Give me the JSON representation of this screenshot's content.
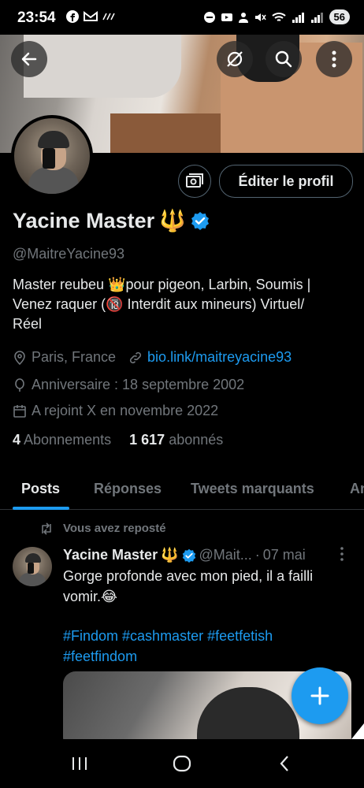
{
  "status_bar": {
    "time": "23:54",
    "battery": "56"
  },
  "profile": {
    "edit_button_label": "Éditer le profil",
    "display_name": "Yacine Master",
    "name_emoji": "🔱",
    "handle": "@MaitreYacine93",
    "bio_line1": "Master reubeu 👑pour pigeon, Larbin, Soumis |",
    "bio_line2": "Venez raquer  (🔞 Interdit aux mineurs)  Virtuel/",
    "bio_line3": "Réel",
    "location": "Paris, France",
    "link": "bio.link/maitreyacine93",
    "birthday": "Anniversaire : 18 septembre 2002",
    "joined": "A rejoint X en novembre 2022",
    "following_count": "4",
    "following_label": "Abonnements",
    "followers_count": "1 617",
    "followers_label": "abonnés"
  },
  "tabs": [
    {
      "label": "Posts"
    },
    {
      "label": "Réponses"
    },
    {
      "label": "Tweets marquants"
    },
    {
      "label": "An"
    }
  ],
  "tweet": {
    "repost_label": "Vous avez reposté",
    "author_name": "Yacine Master",
    "author_emoji": "🔱",
    "author_handle": "@Mait...",
    "separator": "·",
    "date": "07 mai",
    "text": "Gorge profonde avec mon pied, il a failli vomir.😂",
    "hashtags_line1": "#Findom #cashmaster #feetfetish",
    "hashtags_line2": "#feetfindom"
  },
  "colors": {
    "accent": "#1d9bf0",
    "muted": "#71767b",
    "text": "#e7e9ea"
  }
}
